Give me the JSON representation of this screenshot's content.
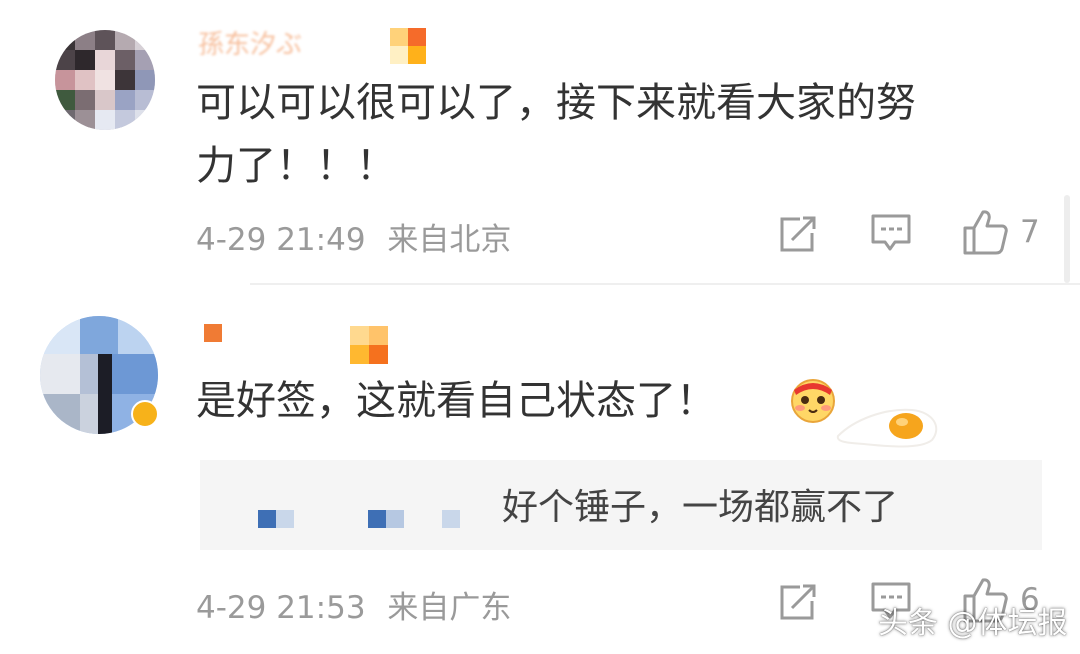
{
  "comments": [
    {
      "username": "孫东汐ぶ",
      "text_line1": "可以可以很可以了，接下来就看大家的努",
      "text_line2": "力了！！！",
      "date": "4-29 21:49",
      "location": "来自北京",
      "likes": "7"
    },
    {
      "text": "是好签，这就看自己状态了！",
      "reply": "好个锤子，一场都赢不了",
      "date": "4-29 21:53",
      "location": "来自广东",
      "likes": "6"
    }
  ],
  "watermark": "头条 @体坛报",
  "icons": [
    "repost-icon",
    "comment-icon",
    "thumbs-up-icon",
    "emoji-sticker-icon",
    "fried-egg-sticker-icon"
  ]
}
